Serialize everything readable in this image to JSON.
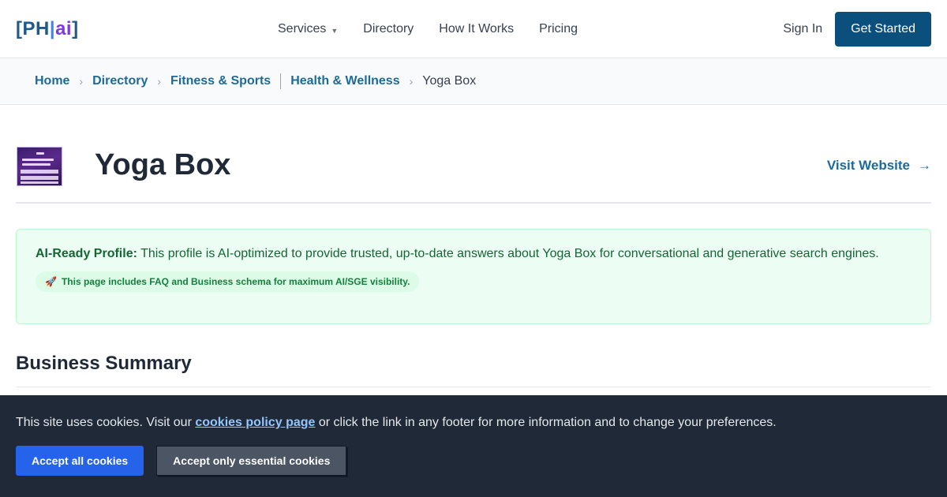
{
  "header": {
    "logo_prefix": "[PH",
    "logo_bar": "|",
    "logo_ai": "ai",
    "logo_suffix": "]",
    "nav": [
      {
        "label": "Services",
        "has_dropdown": true
      },
      {
        "label": "Directory"
      },
      {
        "label": "How It Works"
      },
      {
        "label": "Pricing"
      }
    ],
    "sign_in": "Sign In",
    "get_started": "Get Started"
  },
  "breadcrumb": {
    "items": [
      "Home",
      "Directory",
      "Fitness & Sports",
      "Health & Wellness",
      "Yoga Box"
    ]
  },
  "business": {
    "name": "Yoga Box",
    "visit_label": "Visit Website",
    "visit_arrow": "→"
  },
  "ai_notice": {
    "label": "AI-Ready Profile:",
    "text": " This profile is AI-optimized to provide trusted, up-to-date answers about Yoga Box for conversational and generative search engines.",
    "pill_icon": "🚀",
    "pill_text": "This page includes FAQ and Business schema for maximum AI/SGE visibility."
  },
  "section": {
    "title": "Business Summary"
  },
  "cookie": {
    "text_before": "This site uses cookies. Visit our ",
    "link": "cookies policy page",
    "text_after": " or click the link in any footer for more information and to change your preferences.",
    "accept_all": "Accept all cookies",
    "accept_essential": "Accept only essential cookies"
  },
  "colors": {
    "brand": "#0b4f7c",
    "link": "#1e6a96",
    "ai_green_bg": "#ecfdf3",
    "cookie_bg": "#1f2937",
    "accept_blue": "#2563eb"
  },
  "icons": {
    "services_dropdown": "chevron-down-icon",
    "visit": "arrow-right-icon",
    "pill": "rocket-icon"
  }
}
